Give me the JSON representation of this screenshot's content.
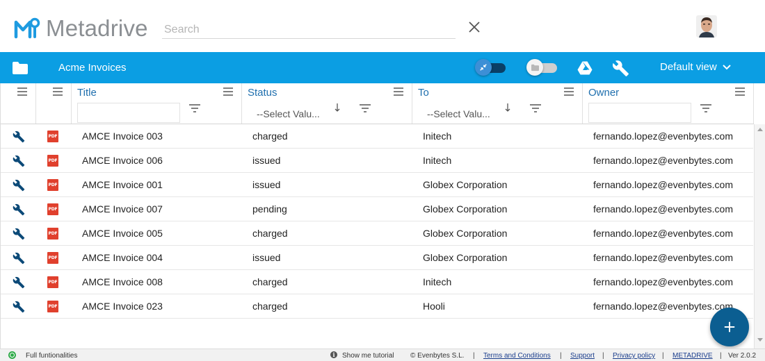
{
  "app": {
    "name": "Metadrive"
  },
  "search": {
    "placeholder": "Search",
    "value": ""
  },
  "toolbar": {
    "breadcrumb": "Acme Invoices",
    "view_label": "Default view"
  },
  "grid": {
    "columns": [
      {
        "title": "Title",
        "filter_placeholder": ""
      },
      {
        "title": "Status",
        "filter_select": "--Select Valu..."
      },
      {
        "title": "To",
        "filter_select": "--Select Valu..."
      },
      {
        "title": "Owner",
        "filter_placeholder": ""
      }
    ],
    "rows": [
      {
        "title": "AMCE Invoice 003",
        "status": "charged",
        "to": "Initech",
        "owner": "fernando.lopez@evenbytes.com",
        "type": "PDF"
      },
      {
        "title": "AMCE Invoice 006",
        "status": "issued",
        "to": "Initech",
        "owner": "fernando.lopez@evenbytes.com",
        "type": "PDF"
      },
      {
        "title": "AMCE Invoice 001",
        "status": "issued",
        "to": "Globex Corporation",
        "owner": "fernando.lopez@evenbytes.com",
        "type": "PDF"
      },
      {
        "title": "AMCE Invoice 007",
        "status": "pending",
        "to": "Globex Corporation",
        "owner": "fernando.lopez@evenbytes.com",
        "type": "PDF"
      },
      {
        "title": "AMCE Invoice 005",
        "status": "charged",
        "to": "Globex Corporation",
        "owner": "fernando.lopez@evenbytes.com",
        "type": "PDF"
      },
      {
        "title": "AMCE Invoice 004",
        "status": "issued",
        "to": "Globex Corporation",
        "owner": "fernando.lopez@evenbytes.com",
        "type": "PDF"
      },
      {
        "title": "AMCE Invoice 008",
        "status": "charged",
        "to": "Initech",
        "owner": "fernando.lopez@evenbytes.com",
        "type": "PDF"
      },
      {
        "title": "AMCE Invoice 023",
        "status": "charged",
        "to": "Hooli",
        "owner": "fernando.lopez@evenbytes.com",
        "type": "PDF"
      }
    ]
  },
  "footer": {
    "status_text": "Full funtionalities",
    "tutorial": "Show me tutorial",
    "copyright": "© Evenbytes S.L.",
    "terms": "Terms and Conditions",
    "support": "Support",
    "privacy": "Privacy policy",
    "brand": "METADRIVE",
    "version": "Ver 2.0.2",
    "separator": "|"
  },
  "colors": {
    "toolbar": "#0b9ee3",
    "header_title": "#1f6fae",
    "fab": "#0b5e91",
    "pdf": "#e0402d",
    "status_ok": "#2eaa48"
  },
  "icons": {
    "clear": "close-icon",
    "folder": "folder-icon",
    "drive": "google-drive-icon",
    "tools": "wrench-icon",
    "menu": "hamburger-icon",
    "filter": "filter-icon",
    "sort": "sort-down-icon",
    "add": "plus-icon",
    "info": "info-icon"
  }
}
